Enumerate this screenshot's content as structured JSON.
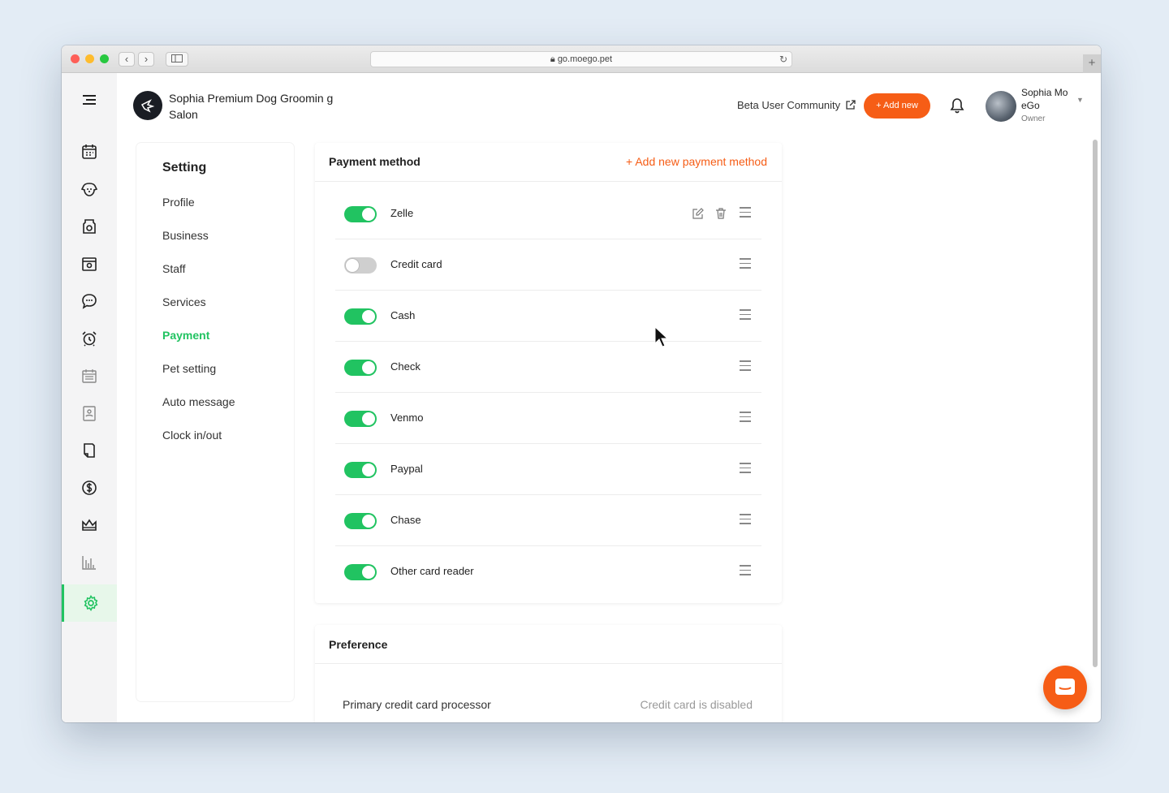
{
  "browser": {
    "url": "go.moego.pet"
  },
  "header": {
    "business_name": "Sophia Premium Dog Groomin g Salon",
    "beta_link": "Beta User Community",
    "add_new_label": "+ Add new",
    "user_name": "Sophia Mo eGo",
    "user_role": "Owner"
  },
  "colors": {
    "accent_orange": "#f65d16",
    "accent_green": "#21c361"
  },
  "rail_icons": [
    "menu-icon",
    "calendar-icon",
    "dog-icon",
    "shop-icon",
    "book-icon",
    "chat-icon",
    "alarm-icon",
    "schedule-icon",
    "contact-icon",
    "doc-icon",
    "dollar-icon",
    "crown-icon",
    "chart-icon",
    "settings-icon"
  ],
  "settings_nav": {
    "title": "Setting",
    "items": [
      {
        "label": "Profile",
        "active": false
      },
      {
        "label": "Business",
        "active": false
      },
      {
        "label": "Staff",
        "active": false
      },
      {
        "label": "Services",
        "active": false
      },
      {
        "label": "Payment",
        "active": true
      },
      {
        "label": "Pet setting",
        "active": false
      },
      {
        "label": "Auto message",
        "active": false
      },
      {
        "label": "Clock in/out",
        "active": false
      }
    ]
  },
  "payment_method": {
    "title": "Payment method",
    "add_label": "+ Add new payment method",
    "methods": [
      {
        "label": "Zelle",
        "enabled": true
      },
      {
        "label": "Credit card",
        "enabled": false
      },
      {
        "label": "Cash",
        "enabled": true
      },
      {
        "label": "Check",
        "enabled": true
      },
      {
        "label": "Venmo",
        "enabled": true
      },
      {
        "label": "Paypal",
        "enabled": true
      },
      {
        "label": "Chase",
        "enabled": true
      },
      {
        "label": "Other card reader",
        "enabled": true
      }
    ]
  },
  "preference": {
    "title": "Preference",
    "row_label": "Primary credit card processor",
    "row_value": "Credit card is disabled"
  }
}
